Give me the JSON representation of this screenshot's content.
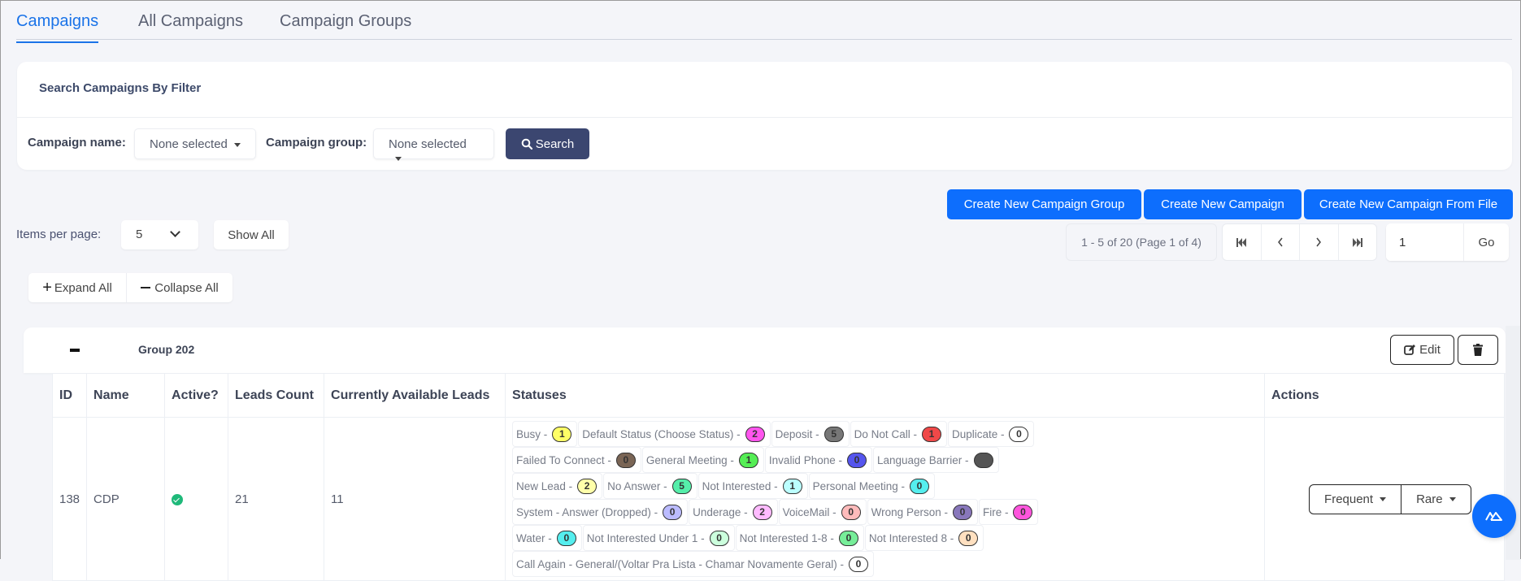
{
  "tabs": [
    {
      "label": "Campaigns",
      "active": true
    },
    {
      "label": "All Campaigns",
      "active": false
    },
    {
      "label": "Campaign Groups",
      "active": false
    }
  ],
  "filter": {
    "title": "Search Campaigns By Filter",
    "campaign_name_label": "Campaign name:",
    "campaign_name_value": "None selected",
    "campaign_group_label": "Campaign group:",
    "campaign_group_value": "None selected",
    "search_label": "Search"
  },
  "create_buttons": {
    "group": "Create New Campaign Group",
    "campaign": "Create New Campaign",
    "from_file": "Create New Campaign From File"
  },
  "pagination": {
    "info": "1 - 5 of 20 (Page 1 of 4)",
    "first_icon": "first-page-icon",
    "prev_icon": "chevron-left-icon",
    "next_icon": "chevron-right-icon",
    "last_icon": "last-page-icon",
    "page_input": "1",
    "go_label": "Go"
  },
  "items_per_page": {
    "label": "Items per page:",
    "value": "5",
    "show_all_label": "Show All"
  },
  "expand_collapse": {
    "expand_label": "Expand All",
    "collapse_label": "Collapse All"
  },
  "group": {
    "name": "Group 202",
    "edit_label": "Edit"
  },
  "table": {
    "headers": {
      "id": "ID",
      "name": "Name",
      "active": "Active?",
      "leads_count": "Leads Count",
      "available_leads": "Currently Available Leads",
      "statuses": "Statuses",
      "actions": "Actions"
    },
    "rows": [
      {
        "id": "138",
        "name": "CDP",
        "active": true,
        "leads_count": "21",
        "available_leads": "11",
        "statuses": [
          {
            "label": "Busy -",
            "count": "1",
            "color": "#ffff66"
          },
          {
            "label": "Default Status (Choose Status) -",
            "count": "2",
            "color": "#ff55ee"
          },
          {
            "label": "Deposit -",
            "count": "5",
            "color": "#777777"
          },
          {
            "label": "Do Not Call -",
            "count": "1",
            "color": "#f04848"
          },
          {
            "label": "Duplicate -",
            "count": "0",
            "color": "#ffffff"
          },
          {
            "label": "Failed To Connect -",
            "count": "0",
            "color": "#7a6555"
          },
          {
            "label": "General Meeting -",
            "count": "1",
            "color": "#55ee55"
          },
          {
            "label": "Invalid Phone -",
            "count": "0",
            "color": "#5555ee"
          },
          {
            "label": "Language Barrier -",
            "count": "",
            "color": "#555555"
          },
          {
            "label": "New Lead -",
            "count": "2",
            "color": "#ffffaa"
          },
          {
            "label": "No Answer -",
            "count": "5",
            "color": "#55eeaa"
          },
          {
            "label": "Not Interested -",
            "count": "1",
            "color": "#bbffff"
          },
          {
            "label": "Personal Meeting -",
            "count": "0",
            "color": "#55eeee"
          },
          {
            "label": "System - Answer (Dropped) -",
            "count": "0",
            "color": "#bbbbff"
          },
          {
            "label": "Underage -",
            "count": "2",
            "color": "#ffbbff"
          },
          {
            "label": "VoiceMail -",
            "count": "0",
            "color": "#ffbbbb"
          },
          {
            "label": "Wrong Person -",
            "count": "0",
            "color": "#8877bb"
          },
          {
            "label": "Fire -",
            "count": "0",
            "color": "#ff55dd"
          },
          {
            "label": "Water -",
            "count": "0",
            "color": "#55eeee"
          },
          {
            "label": "Not Interested Under 1 -",
            "count": "0",
            "color": "#ccffdd"
          },
          {
            "label": "Not Interested 1-8 -",
            "count": "0",
            "color": "#77ee99"
          },
          {
            "label": "Not Interested 8 -",
            "count": "0",
            "color": "#ffe0c0"
          },
          {
            "label": "Call Again - General/(Voltar Pra Lista - Chamar Novamente Geral) -",
            "count": "0",
            "color": "#ffffff"
          }
        ],
        "actions": {
          "frequent_label": "Frequent",
          "rare_label": "Rare"
        }
      }
    ]
  },
  "colors": {
    "accent_blue": "#0d6efd",
    "search_button": "#3b4670",
    "active_tab": "#1a73e8",
    "active_check": "#1fb97a"
  },
  "fab_icon": "assistant-icon"
}
